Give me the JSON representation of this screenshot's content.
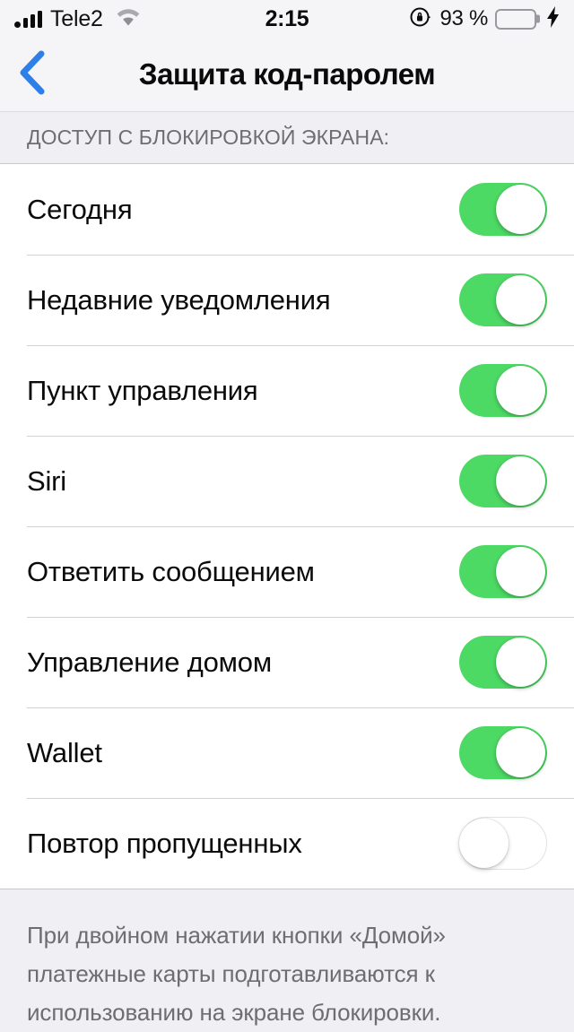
{
  "status_bar": {
    "carrier": "Tele2",
    "signal_icon": "signal-bars-icon",
    "wifi_icon": "wifi-icon",
    "time": "2:15",
    "rotation_lock_icon": "rotation-lock-icon",
    "battery_percent": "93 %",
    "battery_icon": "battery-icon",
    "battery_color": "#4CD964",
    "charging_icon": "lightning-bolt-icon"
  },
  "nav": {
    "back_icon": "chevron-left-icon",
    "back_color": "#2E7FE8",
    "title": "Защита код-паролем"
  },
  "section": {
    "header": "ДОСТУП С БЛОКИРОВКОЙ ЭКРАНА:",
    "rows": [
      {
        "label": "Сегодня",
        "state": "on"
      },
      {
        "label": "Недавние уведомления",
        "state": "on"
      },
      {
        "label": "Пункт управления",
        "state": "on"
      },
      {
        "label": "Siri",
        "state": "on"
      },
      {
        "label": "Ответить сообщением",
        "state": "on"
      },
      {
        "label": "Управление домом",
        "state": "on"
      },
      {
        "label": "Wallet",
        "state": "on"
      },
      {
        "label": "Повтор пропущенных",
        "state": "off"
      }
    ]
  },
  "footer": {
    "text": "При двойном нажатии кнопки «Домой» платежные карты подготавливаются к использованию на экране блокировки."
  },
  "colors": {
    "toggle_on": "#4CD964",
    "accent_blue": "#2E7FE8",
    "page_background": "#EFEFF4"
  }
}
